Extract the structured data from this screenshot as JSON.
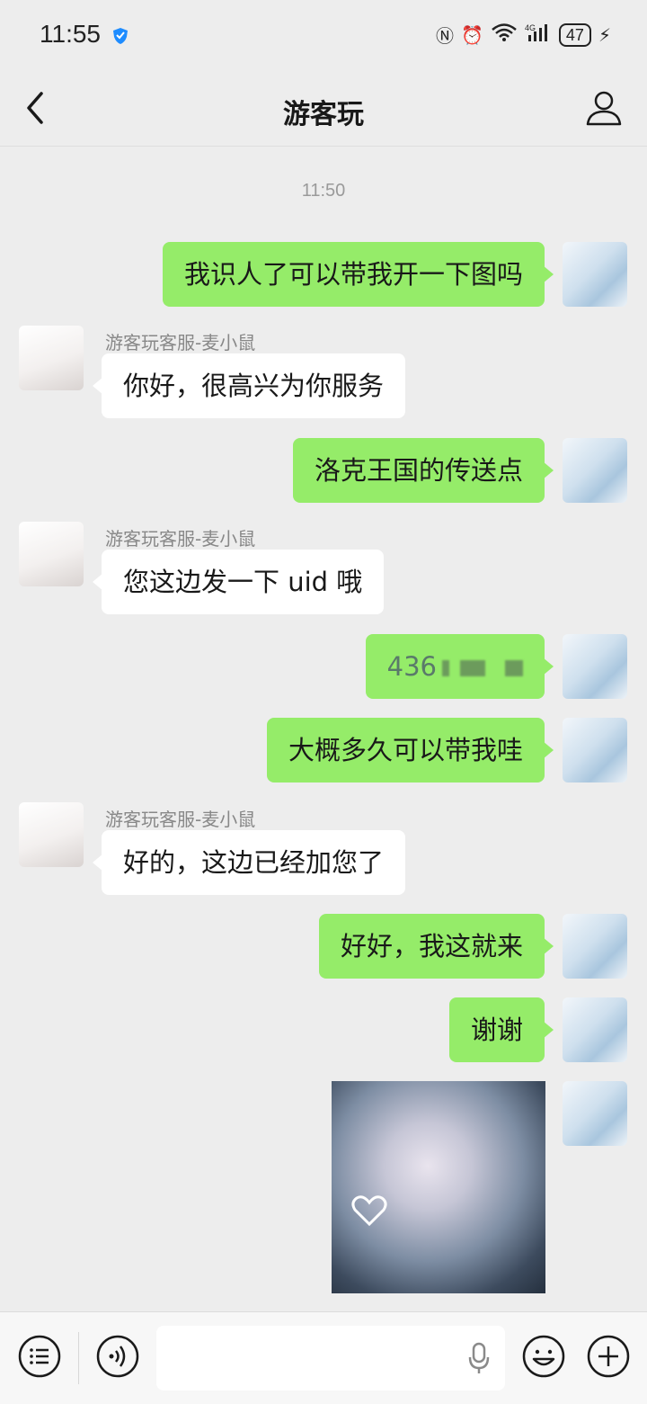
{
  "status_bar": {
    "time": "11:55",
    "battery": "47"
  },
  "header": {
    "title": "游客玩"
  },
  "chat": {
    "timestamp": "11:50",
    "sender_name": "游客玩客服-麦小鼠",
    "messages": [
      {
        "from": "me",
        "text": "我识人了可以带我开一下图吗"
      },
      {
        "from": "cs",
        "text": "你好，很高兴为你服务"
      },
      {
        "from": "me",
        "text": "洛克王国的传送点"
      },
      {
        "from": "cs",
        "text": "您这边发一下 uid 哦"
      },
      {
        "from": "me",
        "text": "436"
      },
      {
        "from": "me",
        "text": "大概多久可以带我哇"
      },
      {
        "from": "cs",
        "text": "好的，这边已经加您了"
      },
      {
        "from": "me",
        "text": "好好，我这就来"
      },
      {
        "from": "me",
        "text": "谢谢"
      },
      {
        "from": "me",
        "type": "image",
        "text": ""
      }
    ]
  },
  "icons": {
    "back": "back-arrow-icon",
    "profile": "user-icon",
    "menu": "list-icon",
    "voice": "voice-icon",
    "mic": "mic-icon",
    "emoji": "emoji-icon",
    "plus": "plus-icon"
  },
  "colors": {
    "my_bubble": "#95ec69",
    "their_bubble": "#ffffff",
    "background": "#ededed"
  }
}
